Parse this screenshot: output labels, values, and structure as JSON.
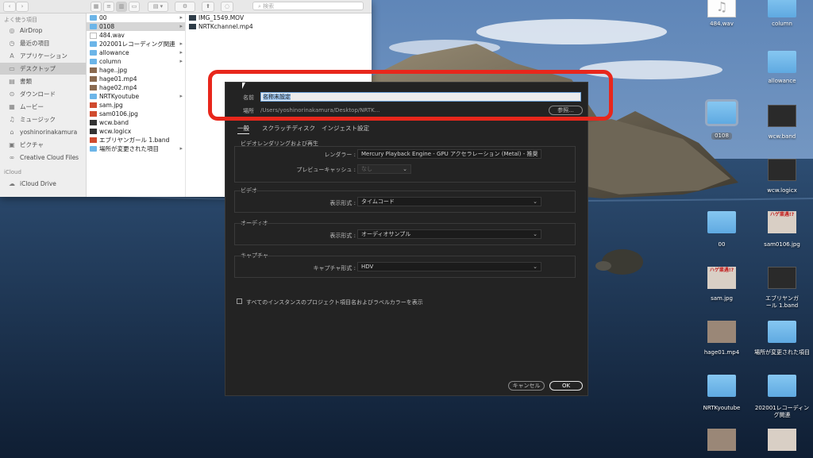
{
  "finder": {
    "search_placeholder": "検索",
    "toolbar": {
      "back": "‹",
      "forward": "›",
      "gear": "⚙",
      "share": "⬆"
    },
    "sidebar": {
      "favorites_heading": "よく使う項目",
      "items": [
        {
          "label": "AirDrop",
          "icon": "◎"
        },
        {
          "label": "最近の項目",
          "icon": "◷"
        },
        {
          "label": "アプリケーション",
          "icon": "A"
        },
        {
          "label": "デスクトップ",
          "icon": "▭"
        },
        {
          "label": "書類",
          "icon": "▤"
        },
        {
          "label": "ダウンロード",
          "icon": "⊙"
        },
        {
          "label": "ムービー",
          "icon": "▦"
        },
        {
          "label": "ミュージック",
          "icon": "♫"
        },
        {
          "label": "yoshinorinakamura",
          "icon": "⌂"
        },
        {
          "label": "ピクチャ",
          "icon": "▣"
        },
        {
          "label": "Creative Cloud Files",
          "icon": "∞"
        }
      ],
      "icloud_heading": "iCloud",
      "icloud_items": [
        {
          "label": "iCloud Drive",
          "icon": "☁"
        }
      ]
    },
    "column1": [
      {
        "name": "00",
        "type": "folder",
        "arrow": "▸"
      },
      {
        "name": "0108",
        "type": "folder",
        "arrow": "▸"
      },
      {
        "name": "484.wav",
        "type": "file",
        "arrow": ""
      },
      {
        "name": "202001レコーディング関連",
        "type": "folder",
        "arrow": "▸"
      },
      {
        "name": "allowance",
        "type": "folder",
        "arrow": "▸"
      },
      {
        "name": "column",
        "type": "folder",
        "arrow": "▸"
      },
      {
        "name": "hage..jpg",
        "type": "thumb",
        "arrow": ""
      },
      {
        "name": "hage01.mp4",
        "type": "thumb",
        "arrow": ""
      },
      {
        "name": "hage02.mp4",
        "type": "thumb",
        "arrow": ""
      },
      {
        "name": "NRTKyoutube",
        "type": "folder",
        "arrow": "▸"
      },
      {
        "name": "sam.jpg",
        "type": "band",
        "arrow": ""
      },
      {
        "name": "sam0106.jpg",
        "type": "band",
        "arrow": ""
      },
      {
        "name": "wcw.band",
        "type": "logic",
        "arrow": ""
      },
      {
        "name": "wcw.logicx",
        "type": "logic",
        "arrow": ""
      },
      {
        "name": "エブリヤンガール 1.band",
        "type": "band",
        "arrow": ""
      },
      {
        "name": "場所が変更された項目",
        "type": "folder",
        "arrow": "▸"
      }
    ],
    "column2": [
      {
        "name": "IMG_1549.MOV",
        "type": "mov"
      },
      {
        "name": "NRTKchannel.mp4",
        "type": "mov"
      }
    ]
  },
  "desktop_icons": [
    {
      "label": "484.wav",
      "kind": "file"
    },
    {
      "label": "column",
      "kind": "folder"
    },
    {
      "label": "allowance",
      "kind": "folder"
    },
    {
      "label": "0108",
      "kind": "folder"
    },
    {
      "label": "wcw.band",
      "kind": "logic"
    },
    {
      "label": "wcw.logicx",
      "kind": "logic"
    },
    {
      "label": "00",
      "kind": "folder"
    },
    {
      "label": "sam0106.jpg",
      "kind": "photo",
      "thumb_text": "ハゲ業遇!?"
    },
    {
      "label": "sam.jpg",
      "kind": "photo",
      "thumb_text": "ハゲ業遇!?"
    },
    {
      "label": "エブリヤンガール 1.band",
      "kind": "logic"
    },
    {
      "label": "hage01.mp4",
      "kind": "video"
    },
    {
      "label": "場所が変更された項目",
      "kind": "folder"
    },
    {
      "label": "NRTKyoutube",
      "kind": "folder"
    },
    {
      "label": "202001レコーディング関連",
      "kind": "folder"
    }
  ],
  "dialog": {
    "name_label": "名前",
    "name_value": "名称未設定",
    "location_label": "場所",
    "location_value": "/Users/yoshinorinakamura/Desktop/NRTK...",
    "browse_label": "参照...",
    "tabs": [
      "一般",
      "スクラッチディスク",
      "インジェスト設定"
    ],
    "sections": {
      "render": {
        "title": "ビデオレンダリングおよび再生",
        "renderer_label": "レンダラー :",
        "renderer_value": "Mercury Playback Engine - GPU アクセラレーション (Metal) - 推奨",
        "preview_cache_label": "プレビューキャッシュ :",
        "preview_cache_value": "なし"
      },
      "video": {
        "title": "ビデオ",
        "format_label": "表示形式 :",
        "format_value": "タイムコード"
      },
      "audio": {
        "title": "オーディオ",
        "format_label": "表示形式 :",
        "format_value": "オーディオサンプル"
      },
      "capture": {
        "title": "キャプチャ",
        "format_label": "キャプチャ形式 :",
        "format_value": "HDV"
      }
    },
    "checkbox_label": "すべてのインスタンスのプロジェクト項目名およびラベルカラーを表示",
    "cancel_label": "キャンセル",
    "ok_label": "OK"
  },
  "colors": {
    "highlight": "#e8271c",
    "dialog_bg": "#232323",
    "folder_blue": "#6cb5e8"
  }
}
